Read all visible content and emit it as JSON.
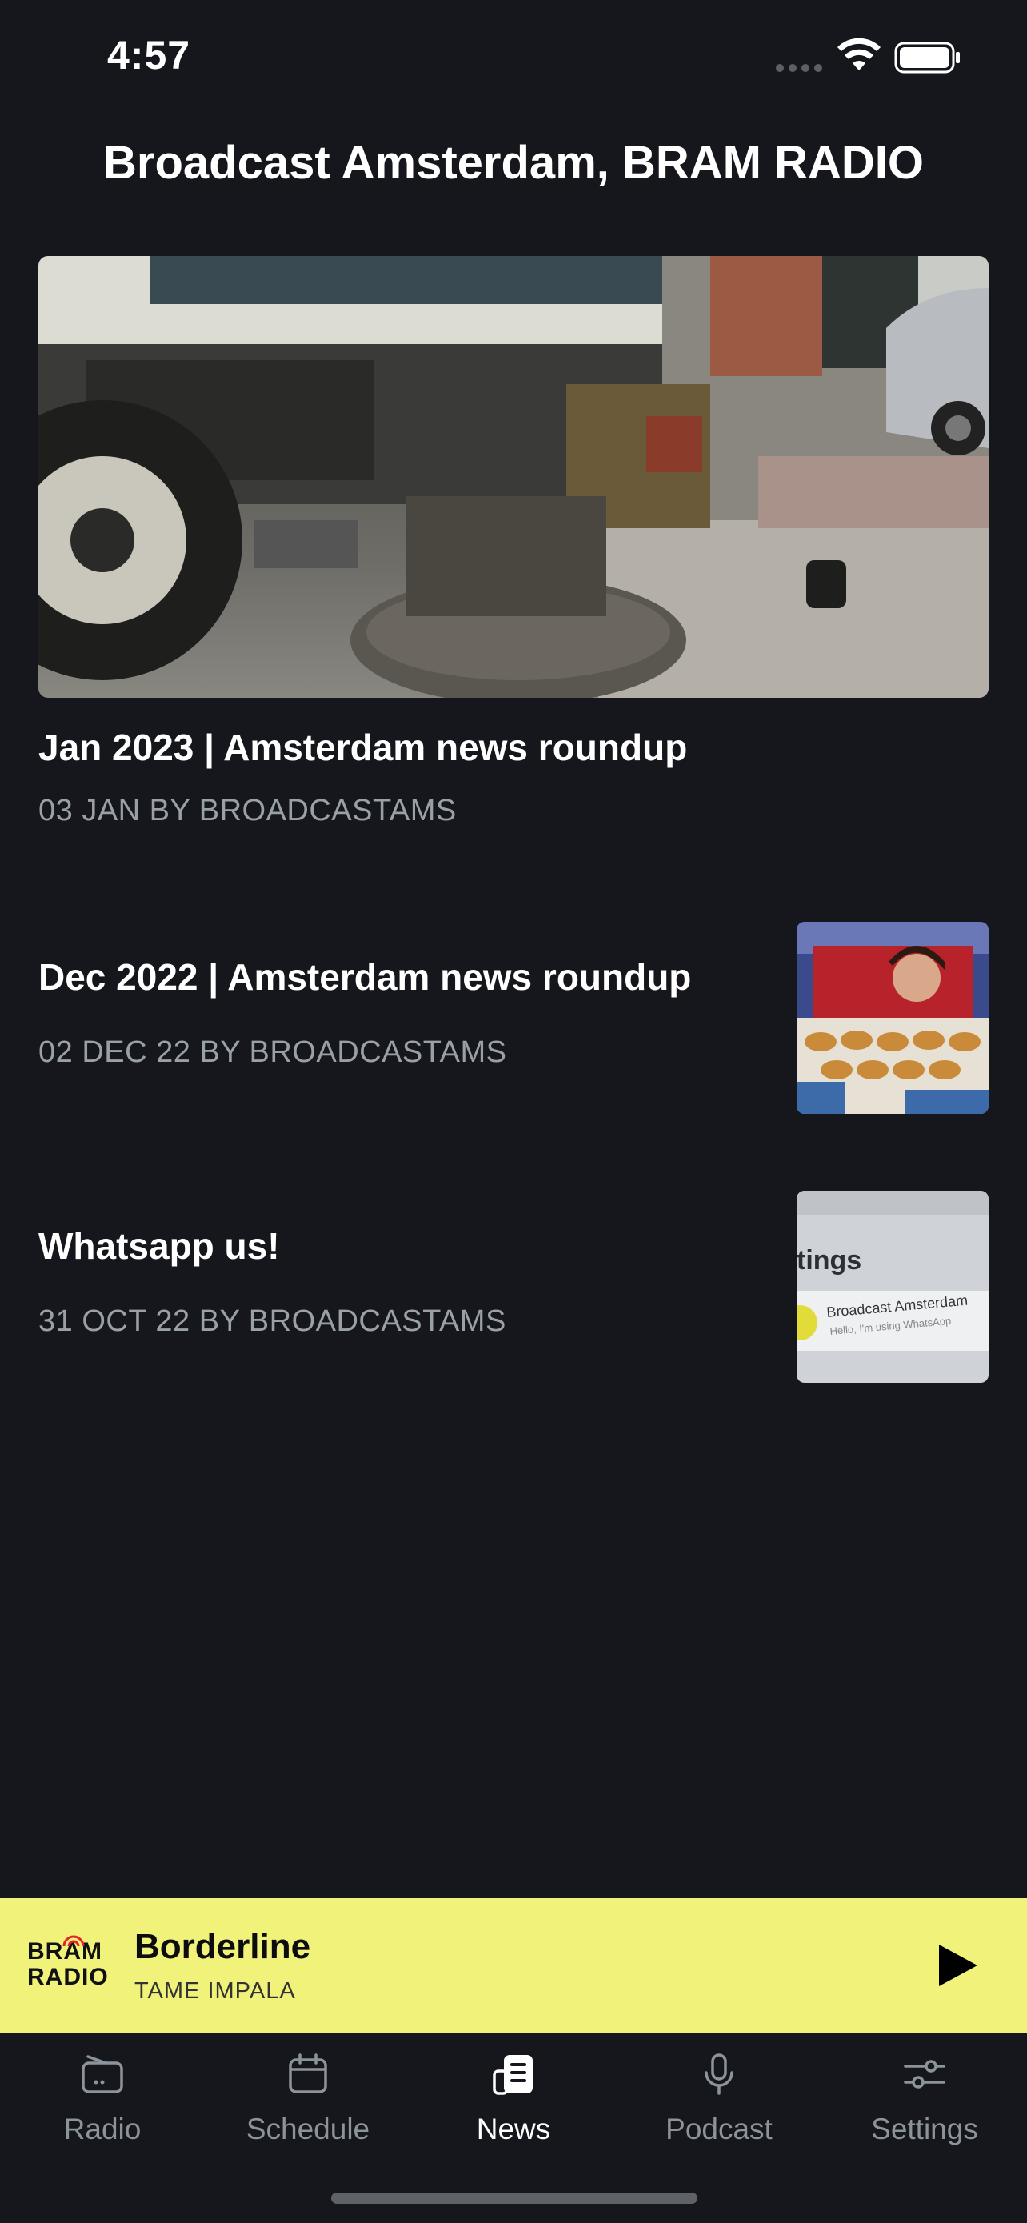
{
  "status_bar": {
    "time": "4:57"
  },
  "header": {
    "title": "Broadcast Amsterdam, BRAM RADIO"
  },
  "featured_article": {
    "title": "Jan 2023 | Amsterdam news roundup",
    "meta": "03 JAN BY BROADCASTAMS"
  },
  "articles": [
    {
      "title": "Dec 2022 | Amsterdam news roundup",
      "meta": "02 DEC 22 BY BROADCASTAMS"
    },
    {
      "title": "Whatsapp us!",
      "meta": "31 OCT 22 BY BROADCASTAMS",
      "thumb_heading": "tings",
      "thumb_name": "Broadcast Amsterdam",
      "thumb_status": "Hello, I'm using WhatsApp"
    }
  ],
  "now_playing": {
    "logo_top": "BRAM",
    "logo_bottom": "RADIO",
    "track": "Borderline",
    "artist": "TAME IMPALA",
    "accent_color": "#f0f27a"
  },
  "tabs": [
    {
      "label": "Radio",
      "icon": "radio-icon",
      "active": false
    },
    {
      "label": "Schedule",
      "icon": "calendar-icon",
      "active": false
    },
    {
      "label": "News",
      "icon": "news-icon",
      "active": true
    },
    {
      "label": "Podcast",
      "icon": "microphone-icon",
      "active": false
    },
    {
      "label": "Settings",
      "icon": "sliders-icon",
      "active": false
    }
  ]
}
